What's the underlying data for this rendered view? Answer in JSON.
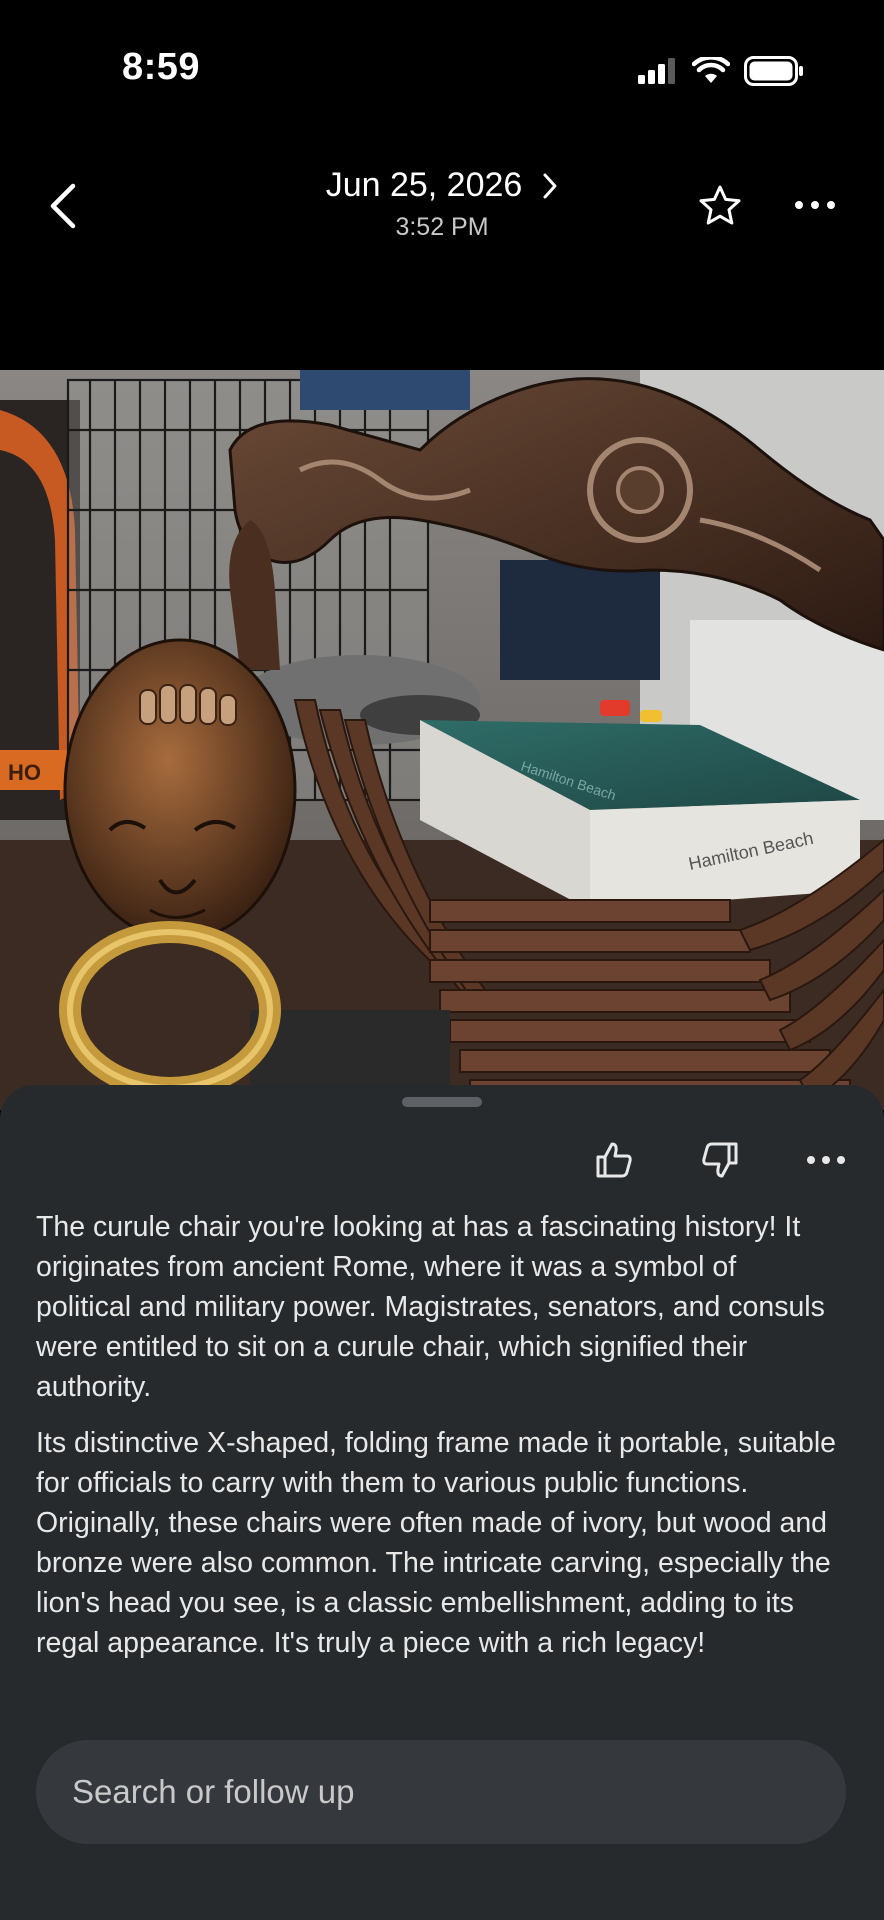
{
  "status_bar": {
    "time": "8:59",
    "icons": [
      "cellular-signal-icon",
      "wifi-icon",
      "battery-icon"
    ]
  },
  "header": {
    "date": "Jun 25, 2026",
    "time": "3:52 PM",
    "icons": {
      "back": "chevron-left-icon",
      "next": "chevron-right-icon",
      "favorite": "star-icon",
      "more": "more-horizontal-icon"
    }
  },
  "photo": {
    "subject": "carved wooden curule chair with lion head and brass ring",
    "box_texts": [
      "Hamilton Beach",
      "Hamilton Beach"
    ]
  },
  "sheet": {
    "feedback_icons": [
      "thumbs-up-icon",
      "thumbs-down-icon",
      "more-horizontal-icon"
    ],
    "paragraphs": [
      "The curule chair you're looking at has a fascinating history! It originates from ancient Rome, where it was a symbol of political and military power. Magistrates, senators, and consuls were entitled to sit on a curule chair, which signified their authority.",
      "Its distinctive X-shaped, folding frame made it portable, suitable for officials to carry with them to various public functions. Originally, these chairs were often made of ivory, but wood and bronze were also common. The intricate carving, especially the lion's head you see, is a classic embellishment, adding to its regal appearance. It's truly a piece with a rich legacy!"
    ],
    "search": {
      "placeholder": "Search or follow up"
    }
  },
  "colors": {
    "background": "#000000",
    "sheet": "#272a2d",
    "search_box": "#35383c",
    "text_primary": "#e8e8e8",
    "text_secondary": "#c8c8c8"
  }
}
